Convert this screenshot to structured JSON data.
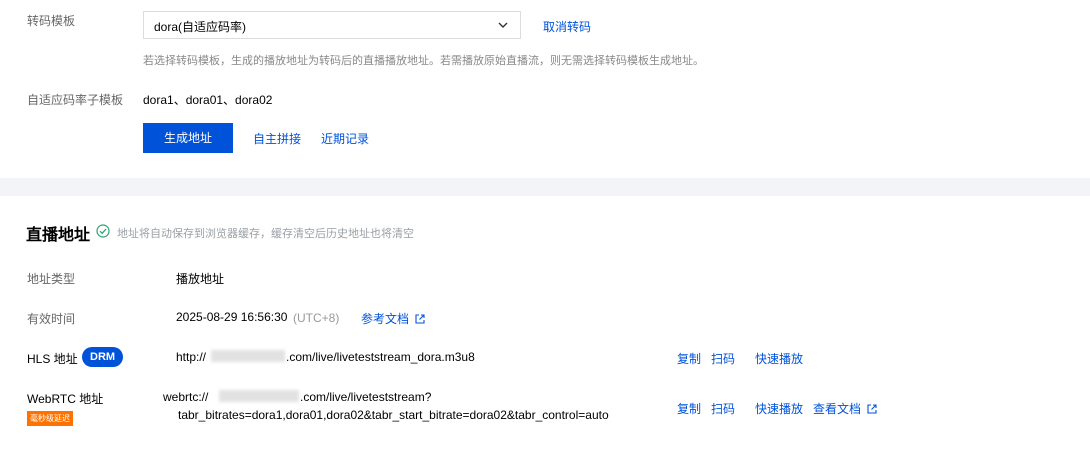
{
  "transcode": {
    "label": "转码模板",
    "selected": "dora(自适应码率)",
    "cancel": "取消转码",
    "hint": "若选择转码模板，生成的播放地址为转码后的直播播放地址。若需播放原始直播流，则无需选择转码模板生成地址。"
  },
  "adaptive": {
    "label": "自适应码率子模板",
    "value": "dora1、dora01、dora02"
  },
  "actions": {
    "generate": "生成地址",
    "custom": "自主拼接",
    "recent": "近期记录"
  },
  "live": {
    "title": "直播地址",
    "hint": "地址将自动保存到浏览器缓存，缓存清空后历史地址也将清空",
    "type_label": "地址类型",
    "type_value": "播放地址",
    "expire_label": "有效时间",
    "expire_value": "2025-08-29 16:56:30",
    "expire_tz": "(UTC+8)",
    "doc_link": "参考文档",
    "hls": {
      "label": "HLS 地址",
      "badge": "DRM",
      "prefix": "http://",
      "suffix": ".com/live/liveteststream_dora.m3u8",
      "copy": "复制",
      "scan": "扫码",
      "play": "快速播放"
    },
    "webrtc": {
      "label": "WebRTC 地址",
      "badge": "毫秒级延迟",
      "prefix": "webrtc://",
      "suffix": ".com/live/liveteststream?",
      "line2": "tabr_bitrates=dora1,dora01,dora02&tabr_start_bitrate=dora02&tabr_control=auto",
      "copy": "复制",
      "scan": "扫码",
      "play": "快速播放",
      "doc": "查看文档"
    }
  },
  "colors": {
    "primary": "#0052d9",
    "success": "#2ba471",
    "badge_orange": "#ff7200"
  }
}
